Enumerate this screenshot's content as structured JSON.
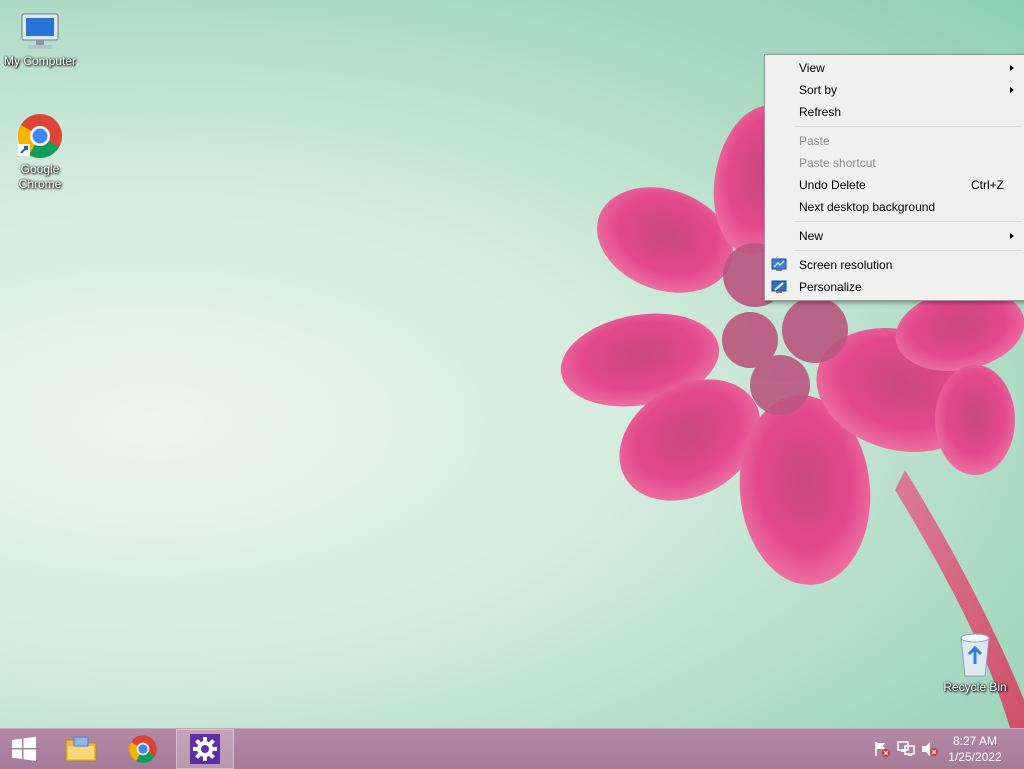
{
  "desktop": {
    "icons": [
      {
        "label": "My Computer",
        "icon": "computer-icon"
      },
      {
        "label": "Google Chrome",
        "icon": "chrome-icon"
      },
      {
        "label": "Recycle Bin",
        "icon": "recycle-bin-icon"
      }
    ]
  },
  "context_menu": {
    "items": [
      {
        "label": "View",
        "submenu": true,
        "enabled": true
      },
      {
        "label": "Sort by",
        "submenu": true,
        "enabled": true
      },
      {
        "label": "Refresh",
        "enabled": true
      },
      {
        "label": "Paste",
        "enabled": false
      },
      {
        "label": "Paste shortcut",
        "enabled": false
      },
      {
        "label": "Undo Delete",
        "shortcut": "Ctrl+Z",
        "enabled": true
      },
      {
        "label": "Next desktop background",
        "enabled": true
      },
      {
        "label": "New",
        "submenu": true,
        "enabled": true
      },
      {
        "label": "Screen resolution",
        "icon": "display-icon",
        "enabled": true
      },
      {
        "label": "Personalize",
        "icon": "personalize-icon",
        "enabled": true
      }
    ]
  },
  "taskbar": {
    "buttons": [
      {
        "name": "start",
        "icon": "windows-logo-icon"
      },
      {
        "name": "file-explorer",
        "icon": "folder-icon"
      },
      {
        "name": "chrome",
        "icon": "chrome-icon"
      },
      {
        "name": "settings",
        "icon": "gear-icon",
        "active": true
      }
    ],
    "tray": [
      {
        "icon": "action-center-flag-icon"
      },
      {
        "icon": "network-icon"
      },
      {
        "icon": "volume-muted-icon"
      }
    ],
    "clock": {
      "time": "8:27 AM",
      "date": "1/25/2022"
    }
  },
  "colors": {
    "taskbar": "#a57b98",
    "menu_bg": "#f0f0f0",
    "flower": "#e0407a",
    "active_app": "#5b2fa6"
  }
}
